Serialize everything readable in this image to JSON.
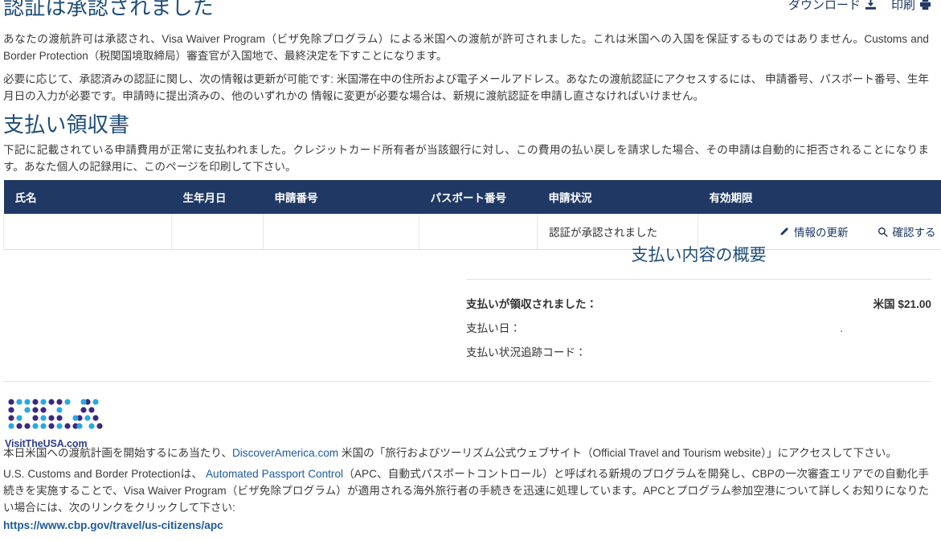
{
  "top_actions": [
    {
      "label": "ダウンロード",
      "icon": "download-icon"
    },
    {
      "label": "印刷",
      "icon": "printer-icon"
    }
  ],
  "approval": {
    "title": "認証は承認されました",
    "paragraph_1": "あなたの渡航許可は承認され、Visa Waiver Program（ビザ免除プログラム）による米国への渡航が許可されました。これは米国への入国を保証するものではありません。Customs and Border Protection（税関国境取締局）審査官が入国地で、最終決定を下すことになります。",
    "paragraph_2": "必要に応じて、承認済みの認証に関し、次の情報は更新が可能です: 米国滞在中の住所および電子メールアドレス。あなたの渡航認証にアクセスするには、 申請番号、パスポート番号、生年月日の入力が必要です。申請時に提出済みの、他のいずれかの 情報に変更が必要な場合は、新規に渡航認証を申請し直さなければいけません。"
  },
  "receipt": {
    "title": "支払い領収書",
    "paragraph": "下記に記載されている申請費用が正常に支払われました。クレジットカード所有者が当該銀行に対し、この費用の払い戻しを請求した場合、その申請は自動的に拒否されることになります。あなた個人の記録用に、このページを印刷して下さい。"
  },
  "table": {
    "headers": [
      "氏名",
      "生年月日",
      "申請番号",
      "パスポート番号",
      "申請状況",
      "有効期限"
    ],
    "row": {
      "name": "",
      "dob": "",
      "application_number": "",
      "passport_number": "",
      "status": "認証が承認されました",
      "expiry": ""
    },
    "actions": [
      {
        "label": "情報の更新",
        "icon": "pencil-icon"
      },
      {
        "label": "確認する",
        "icon": "search-icon"
      }
    ]
  },
  "payment": {
    "title": "支払い内容の概要",
    "rows": [
      {
        "key": "支払いが領収されました：",
        "value": "米国 $21.00",
        "bold": true
      },
      {
        "key": "支払い日：",
        "value": ".",
        "bold": false
      },
      {
        "key": "支払い状況追跡コード：",
        "value": "",
        "bold": false
      }
    ]
  },
  "logo": {
    "wordmark": "VisitTheUSA.com",
    "alt": "usa-dot-logo"
  },
  "footer": {
    "line_1_before": "本日米国への渡航計画を開始するにあ当たり、",
    "line_1_link": "DiscoverAmerica.com",
    "line_1_after": " 米国の「旅行およびツーリズム公式ウェブサイト（Official Travel and Tourism website）」にアクセスして下さい。",
    "line_2_before": "U.S. Customs and Border Protectionは、 ",
    "line_2_link": "Automated Passport Control",
    "line_2_after": "（APC、自動式パスポートコントロール）と呼ばれる新規のプログラムを開発し、CBPの一次審査エリアでの自動化手続きを実施することで、Visa Waiver Program（ビザ免除プログラム）が適用される海外旅行者の手続きを迅速に処理しています。APCとプログラム参加空港について詳しくお知りになりたい場合には、次のリンクをクリックして下さい:",
    "url": "https://www.cbp.gov/travel/us-citizens/apc"
  },
  "colors": {
    "table_header_bg": "#1f3864",
    "heading": "#1f4e79",
    "link": "#1d5a9e",
    "accent_navy": "#1f3864"
  }
}
